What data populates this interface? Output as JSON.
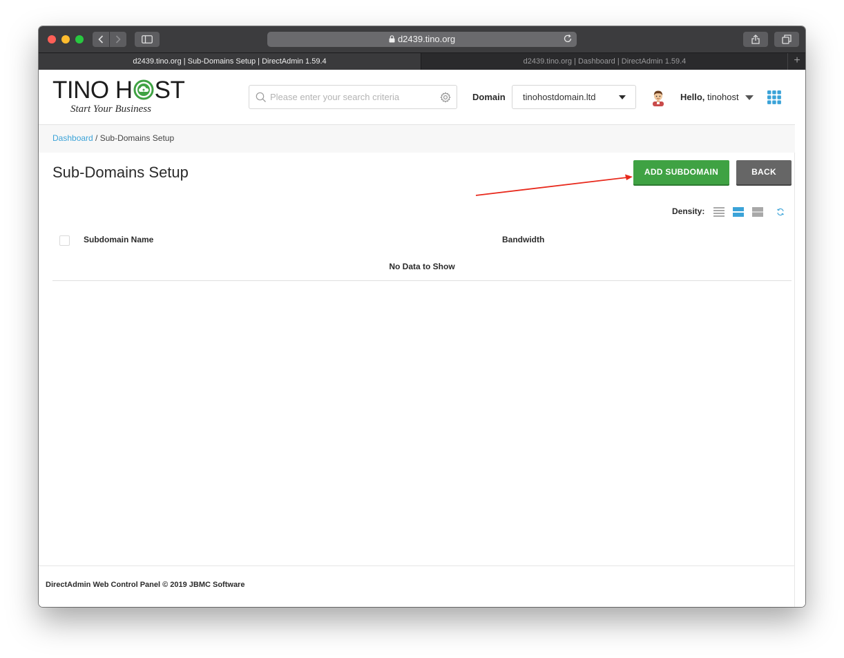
{
  "browser": {
    "url": "d2439.tino.org",
    "tabs": [
      {
        "title": "d2439.tino.org | Sub-Domains Setup | DirectAdmin 1.59.4",
        "active": true
      },
      {
        "title": "d2439.tino.org | Dashboard | DirectAdmin 1.59.4",
        "active": false
      }
    ],
    "new_tab_symbol": "+"
  },
  "header": {
    "logo_text_left": "TINO",
    "logo_text_h": "H",
    "logo_text_right": "ST",
    "logo_tagline": "Start Your Business",
    "search_placeholder": "Please enter your search criteria",
    "domain_label": "Domain",
    "domain_value": "tinohostdomain.ltd",
    "greeting": "Hello,",
    "username": "tinohost"
  },
  "breadcrumb": {
    "link": "Dashboard",
    "separator": " / ",
    "current": "Sub-Domains Setup"
  },
  "main": {
    "title": "Sub-Domains Setup",
    "add_button": "ADD SUBDOMAIN",
    "back_button": "BACK",
    "density_label": "Density:",
    "columns": [
      "Subdomain Name",
      "Bandwidth"
    ],
    "empty_text": "No Data to Show"
  },
  "footer": {
    "text": "DirectAdmin Web Control Panel © 2019 JBMC Software"
  },
  "colors": {
    "accent_link": "#3ba3d8",
    "add_button": "#3fa243",
    "back_button": "#666666",
    "density_active": "#3ba3d8",
    "annotation_arrow": "#e8291c"
  },
  "icons": [
    "back-icon",
    "forward-icon",
    "sidebar-icon",
    "lock-icon",
    "reload-icon",
    "share-icon",
    "tabs-icon",
    "search-icon",
    "gear-icon",
    "chevron-down-icon",
    "avatar",
    "apps-grid-icon",
    "density-compact-icon",
    "density-medium-icon",
    "density-loose-icon",
    "refresh-icon"
  ]
}
